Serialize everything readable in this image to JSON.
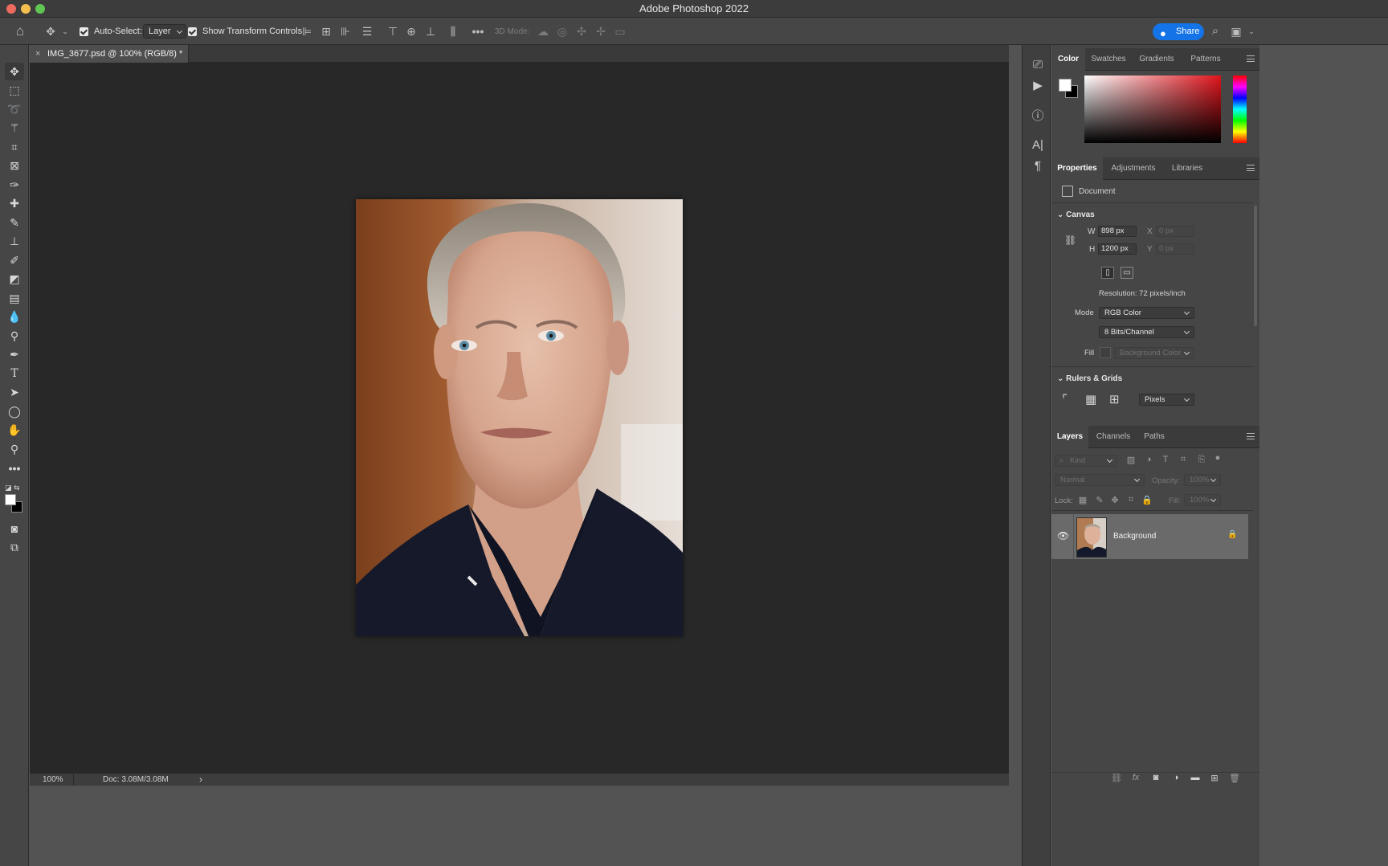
{
  "window": {
    "title": "Adobe Photoshop 2022"
  },
  "options_bar": {
    "auto_select_label": "Auto-Select:",
    "auto_select_value": "Layer",
    "show_transform_label": "Show Transform Controls",
    "three_d_mode_label": "3D Mode:",
    "share_label": "Share"
  },
  "document": {
    "tab_title": "IMG_3677.psd @ 100% (RGB/8) *",
    "zoom": "100%",
    "doc_size": "Doc: 3.08M/3.08M"
  },
  "color_panel": {
    "tabs": [
      "Color",
      "Swatches",
      "Gradients",
      "Patterns"
    ],
    "active_tab": "Color",
    "foreground": "#ffffff",
    "background": "#000000",
    "hue": "#e0141c"
  },
  "properties_panel": {
    "tabs": [
      "Properties",
      "Adjustments",
      "Libraries"
    ],
    "active_tab": "Properties",
    "type_label": "Document",
    "canvas_section": "Canvas",
    "w_label": "W",
    "w_value": "898 px",
    "h_label": "H",
    "h_value": "1200 px",
    "x_label": "X",
    "x_value": "0 px",
    "y_label": "Y",
    "y_value": "0 px",
    "resolution": "Resolution: 72 pixels/inch",
    "mode_label": "Mode",
    "mode_value": "RGB Color",
    "depth_value": "8 Bits/Channel",
    "fill_label": "Fill",
    "fill_value": "Background Color",
    "rulers_section": "Rulers & Grids",
    "units_value": "Pixels"
  },
  "layers_panel": {
    "tabs": [
      "Layers",
      "Channels",
      "Paths"
    ],
    "active_tab": "Layers",
    "filter_placeholder": "Kind",
    "blend_mode": "Normal",
    "opacity_label": "Opacity:",
    "opacity_value": "100%",
    "lock_label": "Lock:",
    "fill_label": "Fill:",
    "fill_value": "100%",
    "layers": [
      {
        "name": "Background",
        "visible": true,
        "locked": true
      }
    ]
  }
}
